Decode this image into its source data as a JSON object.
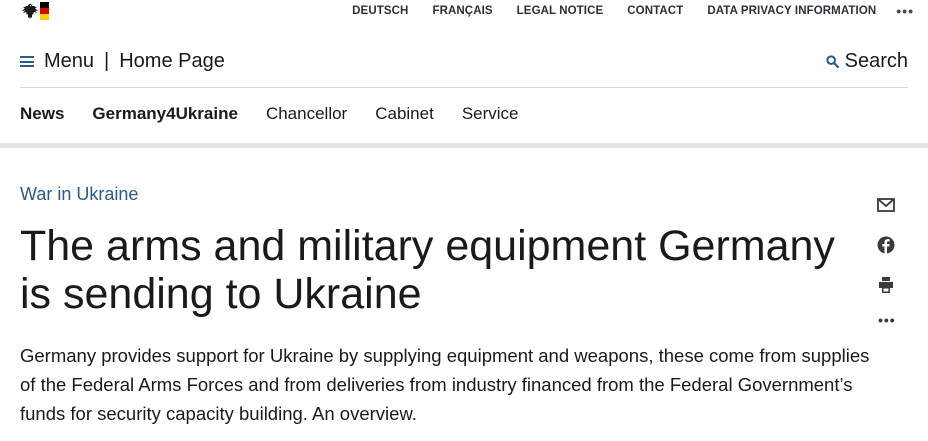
{
  "colors": {
    "accent": "#2a5c8a",
    "text": "#1a1a1a",
    "divider": "#e3e3e3",
    "flag_black": "#000000",
    "flag_red": "#dd0000",
    "flag_gold": "#ffce00"
  },
  "topbar": {
    "logo_icon": "federal-eagle-icon",
    "links": [
      "DEUTSCH",
      "FRANÇAIS",
      "LEGAL NOTICE",
      "CONTACT",
      "DATA PRIVACY INFORMATION"
    ],
    "more": "•••"
  },
  "header": {
    "menu_label": "Menu",
    "separator": "|",
    "home_label": "Home Page",
    "search_label": "Search",
    "search_icon": "search-icon",
    "menu_icon": "hamburger-icon"
  },
  "nav": {
    "items": [
      "News",
      "Germany4Ukraine",
      "Chancellor",
      "Cabinet",
      "Service"
    ]
  },
  "article": {
    "kicker": "War in Ukraine",
    "title": "The arms and military equipment Germany is sending to Ukraine",
    "lead": "Germany provides support for Ukraine by supplying equipment and weapons, these come from supplies of the Federal Arms Forces and from deliveries from industry financed from the Federal Government’s funds for security capacity building. An overview."
  },
  "share": {
    "icons": [
      "mail-icon",
      "facebook-icon",
      "print-icon"
    ],
    "more": "•••"
  }
}
